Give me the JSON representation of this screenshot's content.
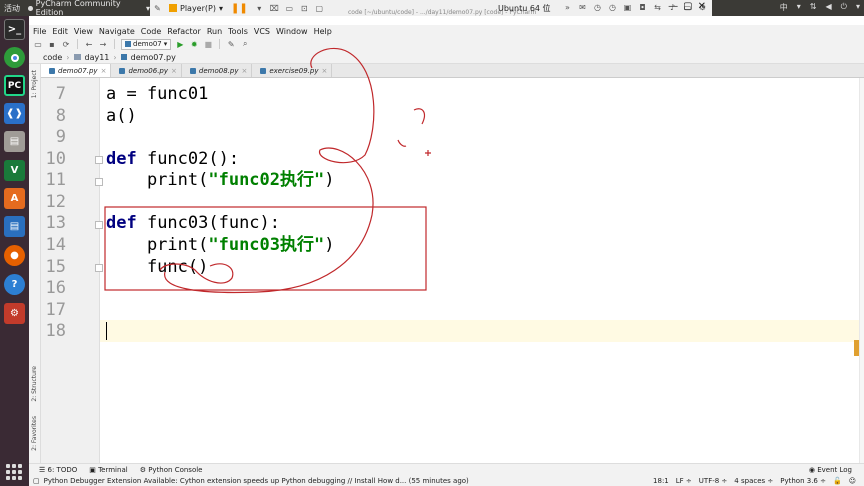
{
  "top_panel": {
    "activities": "活动",
    "app_name": "PyCharm Community Edition",
    "vm_player": "Player(P)",
    "vm_name": "Ubuntu 64 位",
    "window_title": "code [~/ubuntu/code] - .../day11/demo07.py [code] - PyCharm",
    "input_method": "中"
  },
  "menu": [
    "File",
    "Edit",
    "View",
    "Navigate",
    "Code",
    "Refactor",
    "Run",
    "Tools",
    "VCS",
    "Window",
    "Help"
  ],
  "toolbar": {
    "run_config": "demo07"
  },
  "breadcrumb": [
    "code",
    "day11",
    "demo07.py"
  ],
  "side_tabs": {
    "project": "1: Project",
    "structure": "2: Structure",
    "favorites": "2: Favorites"
  },
  "tabs": [
    {
      "label": "demo07.py",
      "active": true
    },
    {
      "label": "demo06.py",
      "active": false
    },
    {
      "label": "demo08.py",
      "active": false
    },
    {
      "label": "exercise09.py",
      "active": false
    }
  ],
  "editor": {
    "line_numbers": [
      "7",
      "8",
      "9",
      "10",
      "11",
      "12",
      "13",
      "14",
      "15",
      "16",
      "17",
      "18"
    ],
    "lines": [
      {
        "kw": "",
        "text": "a = func01",
        "str": "",
        "tail": ""
      },
      {
        "kw": "",
        "text": "a()",
        "str": "",
        "tail": ""
      },
      {
        "kw": "",
        "text": "",
        "str": "",
        "tail": ""
      },
      {
        "kw": "def",
        "text": " func02():",
        "str": "",
        "tail": ""
      },
      {
        "kw": "",
        "text": "    print(",
        "str": "\"func02执行\"",
        "tail": ")"
      },
      {
        "kw": "",
        "text": "",
        "str": "",
        "tail": ""
      },
      {
        "kw": "def",
        "text": " func03(func):",
        "str": "",
        "tail": ""
      },
      {
        "kw": "",
        "text": "    print(",
        "str": "\"func03执行\"",
        "tail": ")"
      },
      {
        "kw": "",
        "text": "    func()",
        "str": "",
        "tail": ""
      },
      {
        "kw": "",
        "text": "",
        "str": "",
        "tail": ""
      },
      {
        "kw": "",
        "text": "",
        "str": "",
        "tail": ""
      },
      {
        "kw": "",
        "text": "",
        "str": "",
        "tail": ""
      }
    ]
  },
  "bottom_tools": [
    "6: TODO",
    "Terminal",
    "Python Console"
  ],
  "event_log": "Event Log",
  "status": {
    "message": "Python Debugger Extension Available: Cython extension speeds up Python debugging // Install How d... (55 minutes ago)",
    "position": "18:1",
    "line_sep": "LF ÷",
    "encoding": "UTF-8 ÷",
    "indent": "4 spaces ÷",
    "interpreter": "Python 3.6 ÷"
  },
  "colors": {
    "keyword": "#000080",
    "string": "#008000",
    "annotation": "#c0282b",
    "launcher": "#3a2a34"
  },
  "icons": [
    "pin-icon",
    "pause-icon",
    "search-icon",
    "folder-icon",
    "save-icon",
    "sync-icon",
    "back-icon",
    "forward-icon",
    "run-icon",
    "debug-icon",
    "stop-icon",
    "wrench-icon",
    "close-icon"
  ]
}
